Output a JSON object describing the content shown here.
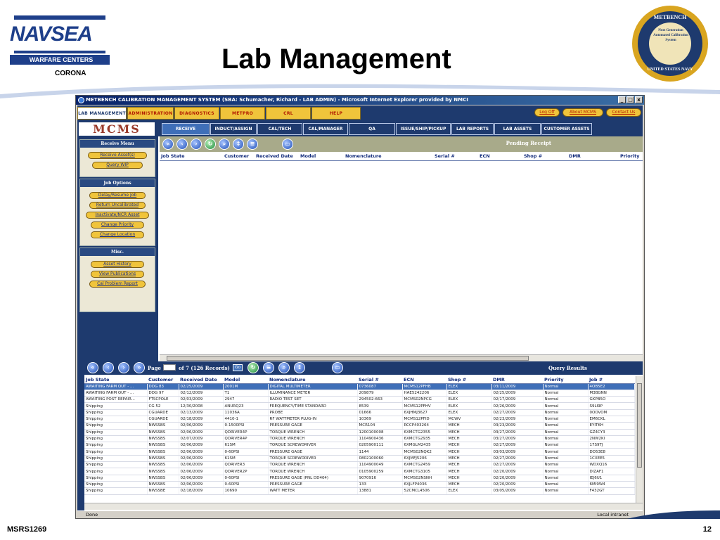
{
  "slide": {
    "title": "Lab Management",
    "logo_text": "NAVSEA",
    "logo_sub": "WARFARE CENTERS",
    "location": "CORONA",
    "seal_top": "METBENCH",
    "seal_center": "Next Generation Automated Calibration System",
    "seal_bottom": "UNITED STATES NAVY",
    "footer_left": "MSRS1269",
    "page_number": "12"
  },
  "window": {
    "title": "METBENCH CALIBRATION MANAGEMENT SYSTEM (SBA: Schumacher, Richard - LAB ADMIN) - Microsoft Internet Explorer provided by NMCI",
    "min": "_",
    "max": "□",
    "close": "x"
  },
  "topnav": {
    "tabs": [
      "LAB MANAGEMENT",
      "ADMINISTRATION",
      "DIAGNOSTICS",
      "METPRO",
      "CRL",
      "HELP"
    ],
    "right": [
      "Log Off",
      "About MCMS",
      "Contact Us"
    ]
  },
  "app_logo": "MCMS",
  "subnav": {
    "tabs": [
      "RECEIVE",
      "INDUCT/ASSIGN",
      "CAL/TECH",
      "CAL/MANAGER",
      "QA",
      "ISSUE/SHIP/PICKUP",
      "LAB REPORTS",
      "LAB ASSETS",
      "CUSTOMER ASSETS"
    ]
  },
  "leftmenu": {
    "receive_head": "Receive Menu",
    "receive_items": [
      "Receive Asset(s)",
      "Query WIP"
    ],
    "job_head": "Job Options",
    "job_items": [
      "Delay/Resume Job",
      "Return Uncalibrated",
      "Inactivate/NCR Asset",
      "Change Priority",
      "Change Location"
    ],
    "misc_head": "Misc.",
    "misc_items": [
      "Asset History",
      "View Publications",
      "Cal Problem Report"
    ]
  },
  "pending": {
    "title": "Pending Receipt",
    "columns": [
      "Job State",
      "Customer",
      "Received Date",
      "Model",
      "Nomenclature",
      "Serial #",
      "ECN",
      "Shop #",
      "DMR",
      "Priority"
    ]
  },
  "query": {
    "title": "Query Results",
    "page_label": "Page",
    "page_of": "of 7 (126 Records)",
    "go": "Go",
    "columns": [
      "Job State",
      "Customer",
      "Received Date",
      "Model",
      "Nomenclature",
      "Serial #",
      "ECN",
      "Shop #",
      "DMR",
      "Priority",
      "Job #"
    ],
    "rows": [
      [
        "AWAITING FARM OUT - ...",
        "DDG 83",
        "02/25/2009",
        "2001M",
        "DIGITAL MULTIMETER",
        "0736087",
        "MCMS12PFHB",
        "ELEX",
        "03/11/2009",
        "Normal",
        "4OB5E2"
      ],
      [
        "AWAITING FARM OUT - ...",
        "DDG 97",
        "02/12/2009",
        "T1",
        "ILLUMINANCE METER",
        "209879",
        "HAE5242206",
        "ELEX",
        "02/25/2009",
        "Normal",
        "M3BGNN"
      ],
      [
        "AWAITING POST REPAIR...",
        "FTSCPOLE",
        "02/03/2009",
        "2947",
        "RADIO TEST SET",
        "294502-663",
        "MCMS02NPCG",
        "ELEX",
        "02/17/2009",
        "Normal",
        "GKPB5O"
      ],
      [
        "Shipping",
        "CG 52",
        "12/30/2008",
        "ANURQ23",
        "FREQUENCY/TIME STANDARD",
        "8539",
        "MCMS12PFHV",
        "ELEX",
        "02/26/2009",
        "Normal",
        "S9LI9P"
      ],
      [
        "Shipping",
        "CGUARDE",
        "02/13/2009",
        "11036A",
        "PROBE",
        "01666",
        "6XJHMJ3627",
        "ELEX",
        "02/27/2009",
        "Normal",
        "0OOVOM"
      ],
      [
        "Shipping",
        "CGUARDE",
        "02/18/2009",
        "4410-1",
        "RF WATTMETER PLUG-IN",
        "10369",
        "MCMS12PFID",
        "MCWV",
        "02/23/2009",
        "Normal",
        "EM6CKL"
      ],
      [
        "Shipping",
        "NWSSBS",
        "02/06/2009",
        "0-1500PSI",
        "PRESSURE GAGE",
        "MCR104",
        "RCCP403264",
        "MECH",
        "03/23/2009",
        "Normal",
        "EYITKH"
      ],
      [
        "Shipping",
        "NWSSBS",
        "02/06/2009",
        "QDRIVER4P",
        "TORQUE WRENCH",
        "1200100008",
        "6XMCTG2355",
        "MECH",
        "03/27/2009",
        "Normal",
        "GZ4CY3"
      ],
      [
        "Shipping",
        "NWSSBS",
        "02/07/2009",
        "QDRIVER4P",
        "TORQUE WRENCH",
        "1104900436",
        "6XMCTG2935",
        "MECH",
        "03/27/2009",
        "Normal",
        "2NW2KI"
      ],
      [
        "Shipping",
        "NWSSBS",
        "02/06/2009",
        "61SM",
        "TORQUE SCREWDRIVER",
        "0205900111",
        "6XMGLM2435",
        "MECH",
        "02/27/2009",
        "Normal",
        "17S9TJ"
      ],
      [
        "Shipping",
        "NWSSBS",
        "02/06/2009",
        "0-60PSI",
        "PRESSURE GAGE",
        "1144",
        "MCMS02NQK2",
        "MECH",
        "03/03/2009",
        "Normal",
        "DD53E8"
      ],
      [
        "Shipping",
        "NWSSBS",
        "02/06/2009",
        "61SM",
        "TORQUE SCREWDRIVER",
        "0802100060",
        "6XJMFJ5206",
        "MECH",
        "02/27/2009",
        "Normal",
        "1CXEE5"
      ],
      [
        "Shipping",
        "NWSSBS",
        "02/06/2009",
        "QDRIVER3",
        "TORQUE WRENCH",
        "1104900049",
        "6XMCTG2459",
        "MECH",
        "02/27/2009",
        "Normal",
        "WDXQ16"
      ],
      [
        "Shipping",
        "NWSSBS",
        "02/06/2009",
        "QDRIVER2P",
        "TORQUE WRENCH",
        "0105900259",
        "6XMCTG3105",
        "MECH",
        "02/20/2009",
        "Normal",
        "DIZAF1"
      ],
      [
        "Shipping",
        "NWSSBS",
        "02/06/2009",
        "0-60PSI",
        "PRESSURE GAGE (PNL DD404)",
        "9070916",
        "MCMS02NSNH",
        "MECH",
        "02/20/2009",
        "Normal",
        "IEJ6U1"
      ],
      [
        "Shipping",
        "NWSSBS",
        "02/06/2009",
        "0-60PSI",
        "PRESSURE GAGE",
        "133",
        "6XJLFP4036",
        "MECH",
        "02/20/2009",
        "Normal",
        "6MI9W4"
      ],
      [
        "Shipping",
        "NWSSBE",
        "02/18/2009",
        "10690",
        "WATT METER",
        "13881",
        "52CMCL4506",
        "ELEX",
        "03/05/2009",
        "Normal",
        "F432GT"
      ]
    ]
  },
  "status": {
    "left": "Done",
    "right": "Local intranet"
  }
}
